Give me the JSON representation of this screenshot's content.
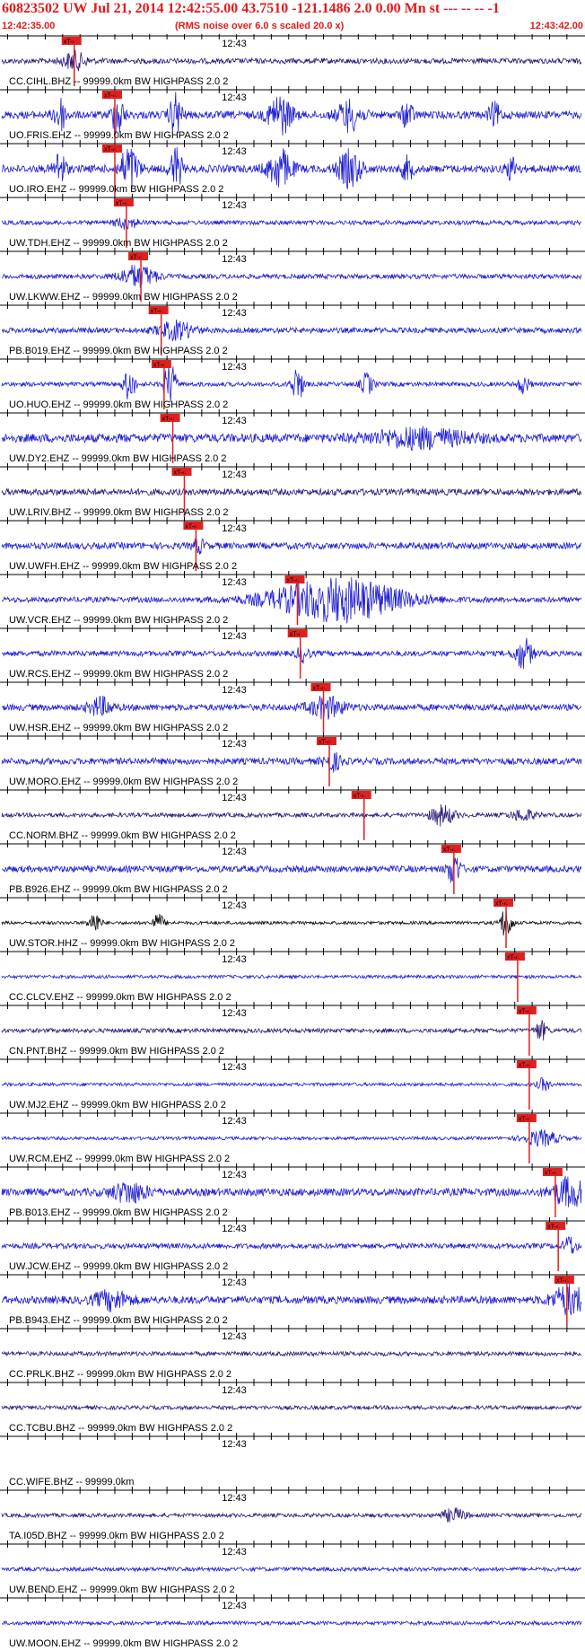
{
  "header": {
    "title": "60823502 UW Jul 21, 2014 12:42:55.00   43.7510 -121.1486  2.0 0.00 Mn st --- -- --  -1",
    "start_time": "12:42:35.00",
    "scale_note": "(RMS noise over 6.0 s scaled 20.0 x)",
    "end_time": "12:43:42.00"
  },
  "chart_data": {
    "type": "line",
    "title": "60823502 UW Jul 21, 2014 12:42:55.00   43.7510 -121.1486  2.0 0.00 Mn st --- -- --  -1",
    "x_range": [
      "12:42:35.00",
      "12:43:42.00"
    ],
    "x_tick_label": "12:43",
    "pick_label": "xT-4",
    "colors": {
      "header_text": "#e21a1a",
      "pick": "#e02020",
      "trace_blue": "#1f1fd6",
      "trace_purple": "#2e1a7a",
      "trace_black": "#101010"
    },
    "traces": [
      {
        "label": "CC.CIHL.BHZ -- 99999.0km BW  HIGHPASS  2.0  2",
        "pick_fraction": 0.125,
        "color": "purple",
        "amp": 0.25,
        "bursts": [
          [
            0.125,
            0.8,
            0.02
          ]
        ]
      },
      {
        "label": "UO.FRIS.EHZ -- 99999.0km BW  HIGHPASS  2.0  2",
        "pick_fraction": 0.195,
        "color": "blue",
        "amp": 0.35,
        "bursts": [
          [
            0.1,
            1.6,
            0.01
          ],
          [
            0.2,
            2.0,
            0.01
          ],
          [
            0.3,
            2.0,
            0.01
          ],
          [
            0.48,
            1.8,
            0.02
          ],
          [
            0.6,
            1.4,
            0.02
          ],
          [
            0.7,
            1.2,
            0.01
          ],
          [
            0.85,
            1.0,
            0.01
          ]
        ]
      },
      {
        "label": "UO.IRO.EHZ -- 99999.0km BW  HIGHPASS  2.0  2",
        "pick_fraction": 0.195,
        "color": "blue",
        "amp": 0.35,
        "bursts": [
          [
            0.1,
            1.6,
            0.01
          ],
          [
            0.22,
            2.0,
            0.015
          ],
          [
            0.3,
            2.0,
            0.01
          ],
          [
            0.48,
            1.8,
            0.02
          ],
          [
            0.6,
            1.6,
            0.02
          ],
          [
            0.7,
            1.0,
            0.01
          ],
          [
            0.88,
            1.0,
            0.01
          ]
        ]
      },
      {
        "label": "UW.TDH.EHZ -- 99999.0km BW  HIGHPASS  2.0  2",
        "pick_fraction": 0.215,
        "color": "blue",
        "amp": 0.2,
        "bursts": [
          [
            0.215,
            0.5,
            0.02
          ]
        ]
      },
      {
        "label": "UW.LKWW.EHZ -- 99999.0km BW  HIGHPASS  2.0  2",
        "pick_fraction": 0.24,
        "color": "blue",
        "amp": 0.22,
        "bursts": [
          [
            0.235,
            1.0,
            0.03
          ]
        ]
      },
      {
        "label": "PB.B019.EHZ -- 99999.0km BW  HIGHPASS  2.0  2",
        "pick_fraction": 0.275,
        "color": "blue",
        "amp": 0.25,
        "bursts": [
          [
            0.3,
            0.8,
            0.03
          ]
        ]
      },
      {
        "label": "UO.HUO.EHZ -- 99999.0km BW  HIGHPASS  2.0  2",
        "pick_fraction": 0.28,
        "color": "blue",
        "amp": 0.2,
        "bursts": [
          [
            0.22,
            1.4,
            0.01
          ],
          [
            0.29,
            2.0,
            0.01
          ],
          [
            0.51,
            1.6,
            0.01
          ],
          [
            0.63,
            1.0,
            0.01
          ],
          [
            0.9,
            0.8,
            0.01
          ]
        ]
      },
      {
        "label": "UW.DY2.EHZ -- 99999.0km BW  HIGHPASS  2.0  2",
        "pick_fraction": 0.295,
        "color": "blue",
        "amp": 0.4,
        "bursts": [
          [
            0.72,
            0.8,
            0.08
          ]
        ]
      },
      {
        "label": "UW.LRIV.BHZ -- 99999.0km BW  HIGHPASS  2.0  2",
        "pick_fraction": 0.315,
        "color": "purple",
        "amp": 0.3,
        "bursts": []
      },
      {
        "label": "UW.UWFH.EHZ -- 99999.0km BW  HIGHPASS  2.0  2",
        "pick_fraction": 0.335,
        "color": "blue",
        "amp": 0.3,
        "bursts": [
          [
            0.34,
            0.6,
            0.01
          ]
        ]
      },
      {
        "label": "UW.VCR.EHZ -- 99999.0km BW  HIGHPASS  2.0  2",
        "pick_fraction": 0.51,
        "color": "blue",
        "amp": 0.25,
        "bursts": [
          [
            0.58,
            2.0,
            0.11
          ]
        ]
      },
      {
        "label": "UW.RCS.EHZ -- 99999.0km BW  HIGHPASS  2.0  2",
        "pick_fraction": 0.515,
        "color": "blue",
        "amp": 0.25,
        "bursts": [
          [
            0.52,
            0.7,
            0.01
          ],
          [
            0.9,
            1.4,
            0.015
          ]
        ]
      },
      {
        "label": "UW.HSR.EHZ -- 99999.0km BW  HIGHPASS  2.0  2",
        "pick_fraction": 0.555,
        "color": "blue",
        "amp": 0.3,
        "bursts": [
          [
            0.17,
            0.8,
            0.02
          ],
          [
            0.56,
            0.9,
            0.03
          ]
        ]
      },
      {
        "label": "UW.MORO.EHZ -- 99999.0km BW  HIGHPASS  2.0  2",
        "pick_fraction": 0.565,
        "color": "blue",
        "amp": 0.3,
        "bursts": [
          [
            0.57,
            0.8,
            0.015
          ]
        ]
      },
      {
        "label": "CC.NORM.BHZ -- 99999.0km BW  HIGHPASS  2.0  2",
        "pick_fraction": 0.625,
        "color": "purple",
        "amp": 0.2,
        "bursts": [
          [
            0.76,
            0.9,
            0.02
          ],
          [
            0.9,
            0.5,
            0.02
          ]
        ]
      },
      {
        "label": "PB.B926.EHZ -- 99999.0km BW  HIGHPASS  2.0  2",
        "pick_fraction": 0.78,
        "color": "blue",
        "amp": 0.3,
        "bursts": [
          [
            0.78,
            1.6,
            0.01
          ]
        ]
      },
      {
        "label": "UW.STOR.HHZ -- 99999.0km BW  HIGHPASS  2.0  2",
        "pick_fraction": 0.87,
        "color": "black",
        "amp": 0.15,
        "bursts": [
          [
            0.16,
            1.0,
            0.01
          ],
          [
            0.27,
            0.8,
            0.01
          ],
          [
            0.87,
            1.5,
            0.01
          ]
        ]
      },
      {
        "label": "CC.CLCV.EHZ -- 99999.0km BW  HIGHPASS  2.0  2",
        "pick_fraction": 0.89,
        "color": "blue",
        "amp": 0.15,
        "bursts": []
      },
      {
        "label": "CN.PNT.BHZ -- 99999.0km BW  HIGHPASS  2.0  2",
        "pick_fraction": 0.91,
        "color": "purple",
        "amp": 0.2,
        "bursts": [
          [
            0.93,
            0.9,
            0.01
          ]
        ]
      },
      {
        "label": "UW.MJ2.EHZ -- 99999.0km BW  HIGHPASS  2.0  2",
        "pick_fraction": 0.91,
        "color": "blue",
        "amp": 0.15,
        "bursts": [
          [
            0.935,
            0.6,
            0.01
          ]
        ]
      },
      {
        "label": "UW.RCM.EHZ -- 99999.0km BW  HIGHPASS  2.0  2",
        "pick_fraction": 0.91,
        "color": "blue",
        "amp": 0.15,
        "bursts": [
          [
            0.93,
            0.7,
            0.03
          ]
        ]
      },
      {
        "label": "PB.B013.EHZ -- 99999.0km BW  HIGHPASS  2.0  2",
        "pick_fraction": 0.955,
        "color": "blue",
        "amp": 0.35,
        "bursts": [
          [
            0.22,
            0.9,
            0.03
          ],
          [
            0.98,
            1.3,
            0.03
          ]
        ]
      },
      {
        "label": "UW.JCW.EHZ -- 99999.0km BW  HIGHPASS  2.0  2",
        "pick_fraction": 0.96,
        "color": "blue",
        "amp": 0.25,
        "bursts": [
          [
            0.98,
            0.9,
            0.01
          ]
        ]
      },
      {
        "label": "PB.B943.EHZ -- 99999.0km BW  HIGHPASS  2.0  2",
        "pick_fraction": 0.975,
        "color": "blue",
        "amp": 0.35,
        "bursts": [
          [
            0.19,
            0.8,
            0.03
          ],
          [
            0.98,
            1.3,
            0.03
          ]
        ]
      },
      {
        "label": "CC.PRLK.BHZ -- 99999.0km BW  HIGHPASS  2.0  2",
        "pick_fraction": null,
        "color": "purple",
        "amp": 0.2,
        "bursts": []
      },
      {
        "label": "CC.TCBU.BHZ -- 99999.0km BW  HIGHPASS  2.0  2",
        "pick_fraction": null,
        "color": "purple",
        "amp": 0.18,
        "bursts": []
      },
      {
        "label": "CC.WIFE.BHZ -- 99999.0km",
        "pick_fraction": null,
        "color": "none",
        "amp": 0,
        "bursts": []
      },
      {
        "label": "TA.I05D.BHZ -- 99999.0km BW  HIGHPASS  2.0  2",
        "pick_fraction": null,
        "color": "purple",
        "amp": 0.18,
        "bursts": [
          [
            0.78,
            0.6,
            0.02
          ]
        ]
      },
      {
        "label": "UW.BEND.EHZ -- 99999.0km BW  HIGHPASS  2.0  2",
        "pick_fraction": null,
        "color": "blue",
        "amp": 0.18,
        "bursts": []
      },
      {
        "label": "UW.MOON.EHZ -- 99999.0km BW  HIGHPASS  2.0  2",
        "pick_fraction": null,
        "color": "blue",
        "amp": 0.18,
        "bursts": []
      }
    ]
  }
}
